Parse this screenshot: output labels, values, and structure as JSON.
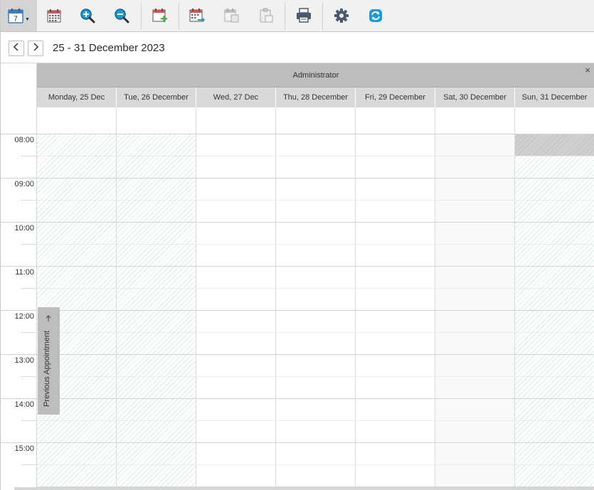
{
  "toolbar": {
    "buttons": [
      {
        "name": "calendar-view-button",
        "icon": "calendar-7-icon",
        "has_dropdown": true
      },
      {
        "name": "month-calendar-button",
        "icon": "calendar-grid-icon"
      },
      {
        "name": "zoom-in-button",
        "icon": "zoom-in-icon"
      },
      {
        "name": "zoom-out-button",
        "icon": "zoom-out-icon"
      },
      {
        "name": "new-appointment-button",
        "icon": "calendar-add-icon"
      },
      {
        "name": "export-calendar-button",
        "icon": "calendar-export-icon"
      },
      {
        "name": "copy-appointment-button",
        "icon": "calendar-copy-icon"
      },
      {
        "name": "paste-appointment-button",
        "icon": "clipboard-paste-icon"
      },
      {
        "name": "print-button",
        "icon": "printer-icon"
      },
      {
        "name": "settings-button",
        "icon": "gear-icon"
      },
      {
        "name": "refresh-button",
        "icon": "refresh-icon"
      }
    ],
    "calendar_icon_day": "7"
  },
  "nav": {
    "date_range": "25 - 31 December 2023"
  },
  "resource": {
    "name": "Administrator",
    "close": "×"
  },
  "days": [
    {
      "label": "Monday, 25 Dec",
      "state": "hatched"
    },
    {
      "label": "Tue, 26 December",
      "state": "hatched"
    },
    {
      "label": "Wed, 27 Dec",
      "state": "normal"
    },
    {
      "label": "Thu, 28 December",
      "state": "normal"
    },
    {
      "label": "Fri, 29 December",
      "state": "normal"
    },
    {
      "label": "Sat, 30 December",
      "state": "weekend"
    },
    {
      "label": "Sun, 31 December",
      "state": "hatched"
    }
  ],
  "times": [
    "08:00",
    "09:00",
    "10:00",
    "11:00",
    "12:00",
    "13:00",
    "14:00",
    "15:00"
  ],
  "previous_appointment": {
    "label": "Previous Appointment",
    "arrow": "←"
  },
  "colors": {
    "accent_blue": "#1a9ad6",
    "calendar_red": "#d9534f",
    "hatch_green": "#d9efe7",
    "header_gray": "#bdbdbd"
  }
}
